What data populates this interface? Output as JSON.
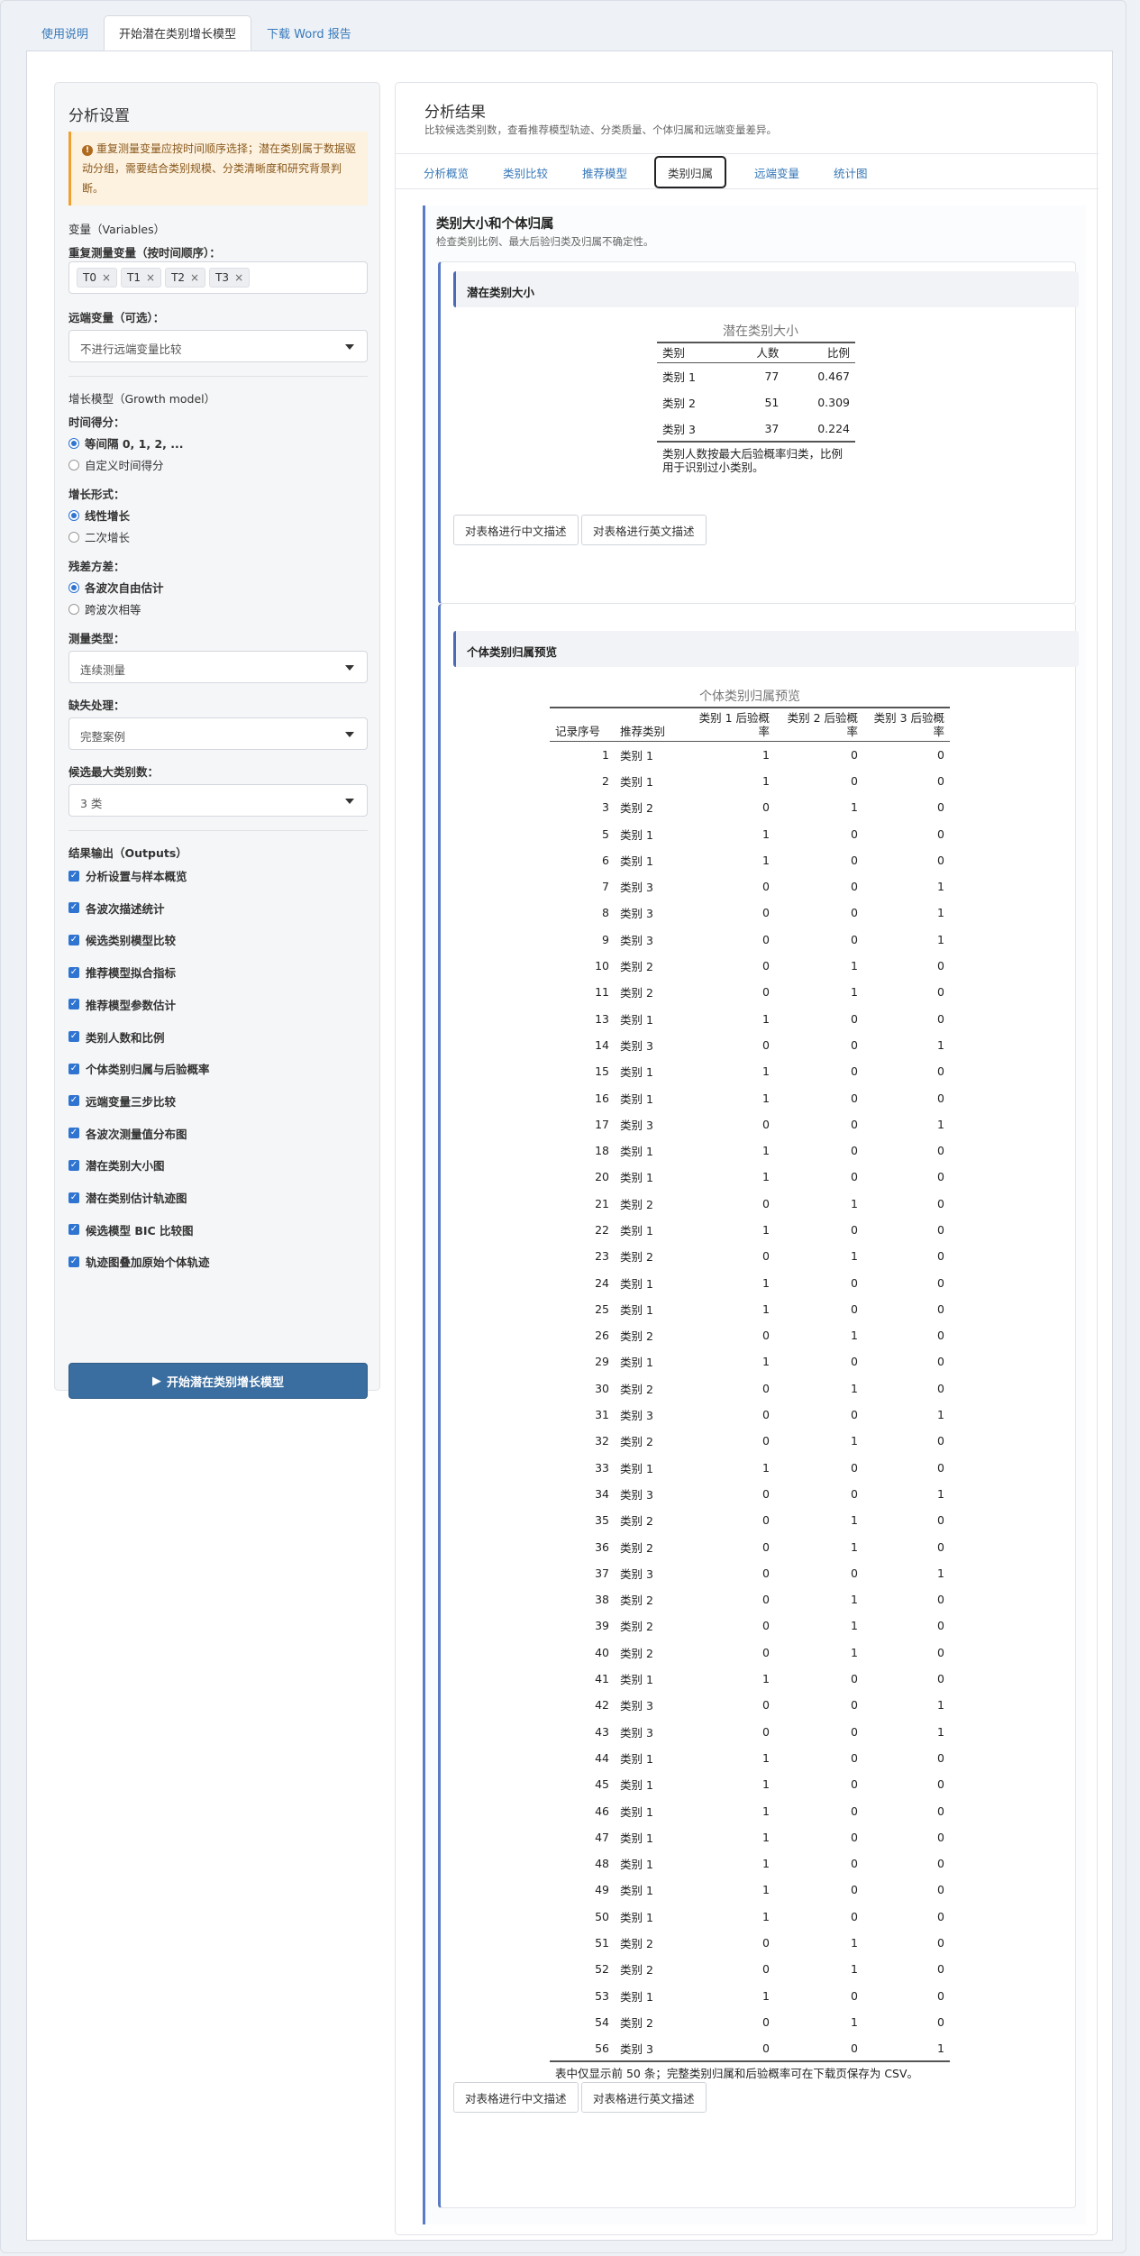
{
  "tabs": [
    "使用说明",
    "开始潜在类别增长模型",
    "下载 Word 报告"
  ],
  "sidebar": {
    "title": "分析设置",
    "alert": "重复测量变量应按时间顺序选择；潜在类别属于数据驱动分组，需要结合类别规模、分类清晰度和研究背景判断。",
    "variables_heading": "变量（Variables）",
    "repeated_label": "重复测量变量（按时间顺序）：",
    "repeated_values": [
      "T0",
      "T1",
      "T2",
      "T3"
    ],
    "distal_label": "远端变量（可选）：",
    "distal_value": "不进行远端变量比较",
    "growth_heading": "增长模型（Growth model）",
    "time_label": "时间得分：",
    "time_opt1": "等间隔 0, 1, 2, ...",
    "time_opt2": "自定义时间得分",
    "form_label": "增长形式：",
    "form_opt1": "线性增长",
    "form_opt2": "二次增长",
    "resid_label": "残差方差：",
    "resid_opt1": "各波次自由估计",
    "resid_opt2": "跨波次相等",
    "measure_label": "测量类型：",
    "measure_value": "连续测量",
    "missing_label": "缺失处理：",
    "missing_value": "完整案例",
    "maxclass_label": "候选最大类别数：",
    "maxclass_value": "3 类",
    "outputs_heading": "结果输出（Outputs）",
    "outputs": [
      "分析设置与样本概览",
      "各波次描述统计",
      "候选类别模型比较",
      "推荐模型拟合指标",
      "推荐模型参数估计",
      "类别人数和比例",
      "个体类别归属与后验概率",
      "远端变量三步比较",
      "各波次测量值分布图",
      "潜在类别大小图",
      "潜在类别估计轨迹图",
      "候选模型 BIC 比较图",
      "轨迹图叠加原始个体轨迹"
    ],
    "run_button": "开始潜在类别增长模型"
  },
  "main": {
    "title": "分析结果",
    "subtitle": "比较候选类别数，查看推荐模型轨迹、分类质量、个体归属和远端变量差异。",
    "subtabs": [
      "分析概览",
      "类别比较",
      "推荐模型",
      "类别归属",
      "远端变量",
      "统计图"
    ],
    "section_title": "类别大小和个体归属",
    "section_sub": "检查类别比例、最大后验归类及归属不确定性。",
    "card1_title": "潜在类别大小",
    "size_table": {
      "caption": "潜在类别大小",
      "headers": [
        "类别",
        "人数",
        "比例"
      ],
      "rows": [
        [
          "类别 1",
          "77",
          "0.467"
        ],
        [
          "类别 2",
          "51",
          "0.309"
        ],
        [
          "类别 3",
          "37",
          "0.224"
        ]
      ],
      "note": "类别人数按最大后验概率归类，比例用于识别过小类别。"
    },
    "btn_cn": "对表格进行中文描述",
    "btn_en": "对表格进行英文描述",
    "card2_title": "个体类别归属预览",
    "member_table": {
      "caption": "个体类别归属预览",
      "headers": [
        "记录序号",
        "推荐类别",
        "类别 1 后验概率",
        "类别 2 后验概率",
        "类别 3 后验概率"
      ],
      "rows": [
        [
          "1",
          "类别 1",
          "1",
          "0",
          "0"
        ],
        [
          "2",
          "类别 1",
          "1",
          "0",
          "0"
        ],
        [
          "3",
          "类别 2",
          "0",
          "1",
          "0"
        ],
        [
          "5",
          "类别 1",
          "1",
          "0",
          "0"
        ],
        [
          "6",
          "类别 1",
          "1",
          "0",
          "0"
        ],
        [
          "7",
          "类别 3",
          "0",
          "0",
          "1"
        ],
        [
          "8",
          "类别 3",
          "0",
          "0",
          "1"
        ],
        [
          "9",
          "类别 3",
          "0",
          "0",
          "1"
        ],
        [
          "10",
          "类别 2",
          "0",
          "1",
          "0"
        ],
        [
          "11",
          "类别 2",
          "0",
          "1",
          "0"
        ],
        [
          "13",
          "类别 1",
          "1",
          "0",
          "0"
        ],
        [
          "14",
          "类别 3",
          "0",
          "0",
          "1"
        ],
        [
          "15",
          "类别 1",
          "1",
          "0",
          "0"
        ],
        [
          "16",
          "类别 1",
          "1",
          "0",
          "0"
        ],
        [
          "17",
          "类别 3",
          "0",
          "0",
          "1"
        ],
        [
          "18",
          "类别 1",
          "1",
          "0",
          "0"
        ],
        [
          "20",
          "类别 1",
          "1",
          "0",
          "0"
        ],
        [
          "21",
          "类别 2",
          "0",
          "1",
          "0"
        ],
        [
          "22",
          "类别 1",
          "1",
          "0",
          "0"
        ],
        [
          "23",
          "类别 2",
          "0",
          "1",
          "0"
        ],
        [
          "24",
          "类别 1",
          "1",
          "0",
          "0"
        ],
        [
          "25",
          "类别 1",
          "1",
          "0",
          "0"
        ],
        [
          "26",
          "类别 2",
          "0",
          "1",
          "0"
        ],
        [
          "29",
          "类别 1",
          "1",
          "0",
          "0"
        ],
        [
          "30",
          "类别 2",
          "0",
          "1",
          "0"
        ],
        [
          "31",
          "类别 3",
          "0",
          "0",
          "1"
        ],
        [
          "32",
          "类别 2",
          "0",
          "1",
          "0"
        ],
        [
          "33",
          "类别 1",
          "1",
          "0",
          "0"
        ],
        [
          "34",
          "类别 3",
          "0",
          "0",
          "1"
        ],
        [
          "35",
          "类别 2",
          "0",
          "1",
          "0"
        ],
        [
          "36",
          "类别 2",
          "0",
          "1",
          "0"
        ],
        [
          "37",
          "类别 3",
          "0",
          "0",
          "1"
        ],
        [
          "38",
          "类别 2",
          "0",
          "1",
          "0"
        ],
        [
          "39",
          "类别 2",
          "0",
          "1",
          "0"
        ],
        [
          "40",
          "类别 2",
          "0",
          "1",
          "0"
        ],
        [
          "41",
          "类别 1",
          "1",
          "0",
          "0"
        ],
        [
          "42",
          "类别 3",
          "0",
          "0",
          "1"
        ],
        [
          "43",
          "类别 3",
          "0",
          "0",
          "1"
        ],
        [
          "44",
          "类别 1",
          "1",
          "0",
          "0"
        ],
        [
          "45",
          "类别 1",
          "1",
          "0",
          "0"
        ],
        [
          "46",
          "类别 1",
          "1",
          "0",
          "0"
        ],
        [
          "47",
          "类别 1",
          "1",
          "0",
          "0"
        ],
        [
          "48",
          "类别 1",
          "1",
          "0",
          "0"
        ],
        [
          "49",
          "类别 1",
          "1",
          "0",
          "0"
        ],
        [
          "50",
          "类别 1",
          "1",
          "0",
          "0"
        ],
        [
          "51",
          "类别 2",
          "0",
          "1",
          "0"
        ],
        [
          "52",
          "类别 2",
          "0",
          "1",
          "0"
        ],
        [
          "53",
          "类别 1",
          "1",
          "0",
          "0"
        ],
        [
          "54",
          "类别 2",
          "0",
          "1",
          "0"
        ],
        [
          "56",
          "类别 3",
          "0",
          "0",
          "1"
        ]
      ],
      "note": "表中仅显示前 50 条；完整类别归属和后验概率可在下载页保存为 CSV。"
    }
  },
  "colors": {
    "accent": "#3a6ea0",
    "link": "#3778b9",
    "section_bar": "#5b7cc4",
    "alert_bg": "#fdf1e0"
  }
}
